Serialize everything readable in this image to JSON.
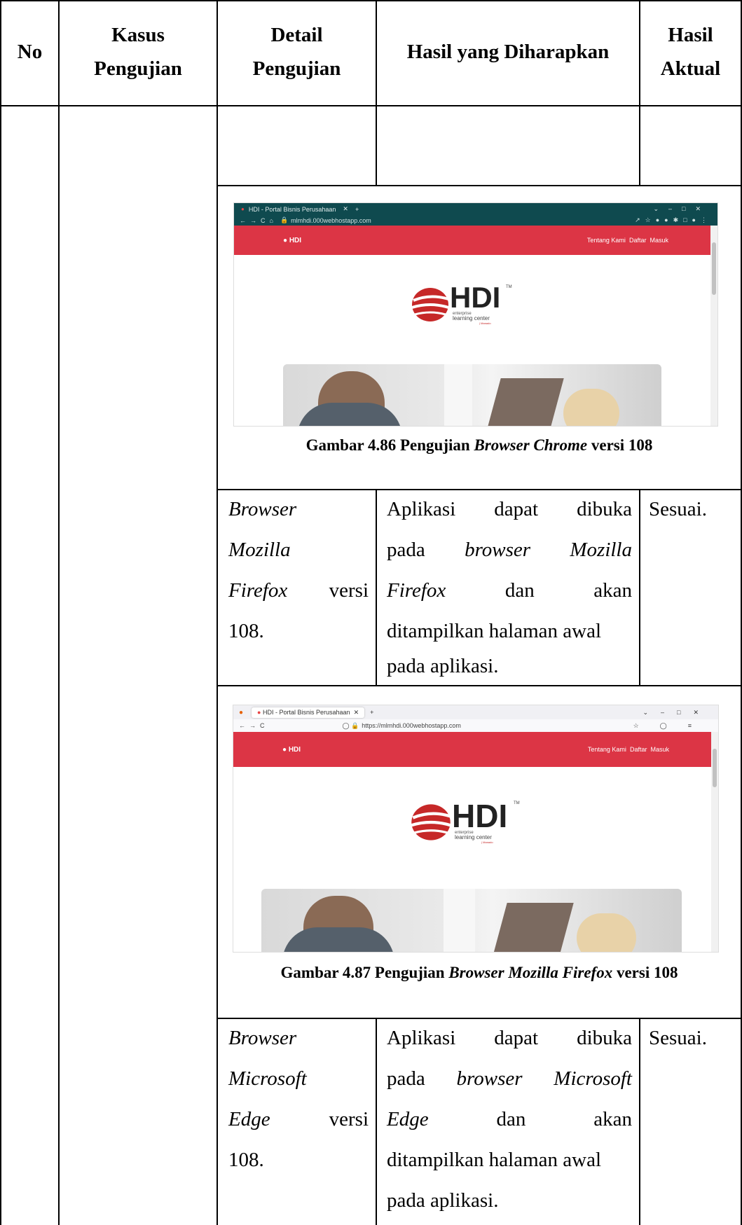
{
  "header": {
    "no": "No",
    "kasus": [
      "Kasus",
      "Pengujian"
    ],
    "detail": [
      "Detail",
      "Pengujian"
    ],
    "hasil_harapan": "Hasil yang Diharapkan",
    "hasil_aktual": [
      "Hasil",
      "Aktual"
    ]
  },
  "rows": [
    {
      "detail": [
        "Browser",
        "Mozilla",
        "Firefox",
        "versi",
        "108."
      ],
      "expected": [
        "Aplikasi",
        "dapat",
        "dibuka",
        "pada",
        "browser",
        "Mozilla",
        "Firefox",
        "dan",
        "akan",
        "ditampilkan halaman awal",
        "pada aplikasi."
      ],
      "actual": "Sesuai."
    },
    {
      "detail": [
        "Browser",
        "Microsoft",
        "Edge",
        "versi",
        "108."
      ],
      "expected": [
        "Aplikasi",
        "dapat",
        "dibuka",
        "pada",
        "browser",
        "Microsoft",
        "Edge",
        "dan",
        "akan",
        "ditampilkan halaman awal",
        "pada aplikasi."
      ],
      "actual": "Sesuai."
    }
  ],
  "figures": [
    {
      "caption_prefix": "Gambar 4.86 Pengujian ",
      "caption_italic": "Browser Chrome",
      "caption_suffix": " versi 108",
      "tab_title": "HDI - Portal Bisnis Perusahaan",
      "url": "mlmhdi.000webhostapp.com",
      "nav": [
        "Tentang Kami",
        "Daftar",
        "Masuk"
      ],
      "logo_text": "HDI",
      "logo_tm": "TM",
      "logo_sub1": "enterprise",
      "logo_sub2": "learning center",
      "logo_sub3": "| Manado",
      "small_logo": "HDI",
      "colors": {
        "chrome": "#0f4a4f",
        "nav": "#dc3545"
      }
    },
    {
      "caption_prefix": "Gambar 4.87 Pengujian ",
      "caption_italic": "Browser Mozilla Firefox",
      "caption_suffix": " versi 108",
      "tab_title": "HDI - Portal Bisnis Perusahaan",
      "url": "https://mlmhdi.000webhostapp.com",
      "nav": [
        "Tentang Kami",
        "Daftar",
        "Masuk"
      ],
      "logo_text": "HDI",
      "logo_tm": "TM",
      "logo_sub1": "enterprise",
      "logo_sub2": "learning center",
      "logo_sub3": "| Manado",
      "small_logo": "HDI",
      "colors": {
        "chrome": "#f0f0f4",
        "nav": "#dc3545"
      }
    }
  ]
}
